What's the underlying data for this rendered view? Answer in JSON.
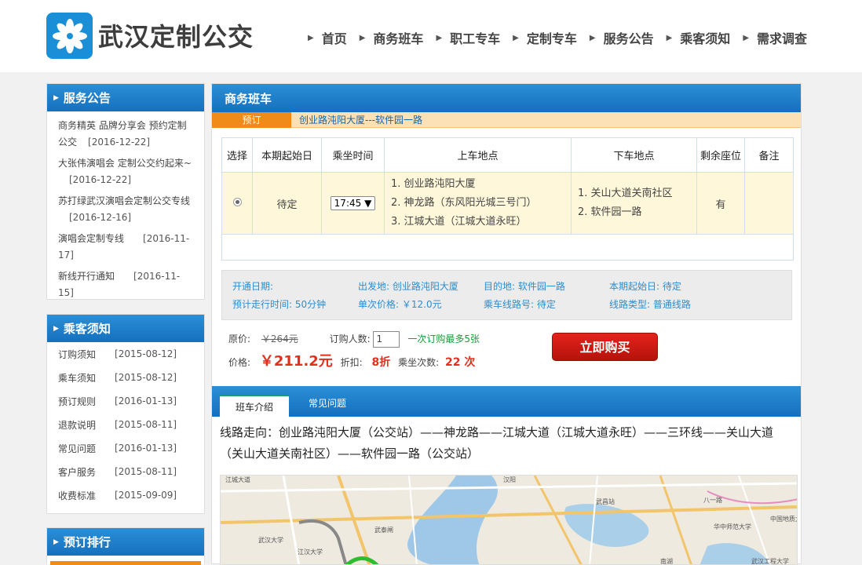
{
  "header": {
    "site_title": "武汉定制公交",
    "nav": [
      "首页",
      "商务班车",
      "职工专车",
      "定制专车",
      "服务公告",
      "乘客须知",
      "需求调查"
    ]
  },
  "sidebar": {
    "announcements": {
      "title": "服务公告",
      "items": [
        {
          "text": "商务精英 品牌分享会 预约定制公交",
          "date": "[2016-12-22]"
        },
        {
          "text": "大张伟演唱会 定制公交约起来~",
          "date": "[2016-12-22]"
        },
        {
          "text": "苏打绿武汉演唱会定制公交专线",
          "date": "[2016-12-16]"
        },
        {
          "text": "演唱会定制专线",
          "date": "[2016-11-17]"
        },
        {
          "text": "新线开行通知",
          "date": "[2016-11-15]"
        }
      ]
    },
    "notices": {
      "title": "乘客须知",
      "items": [
        {
          "text": "订购须知",
          "date": "[2015-08-12]"
        },
        {
          "text": "乘车须知",
          "date": "[2015-08-12]"
        },
        {
          "text": "预订规则",
          "date": "[2016-01-13]"
        },
        {
          "text": "退款说明",
          "date": "[2015-08-11]"
        },
        {
          "text": "常见问题",
          "date": "[2016-01-13]"
        },
        {
          "text": "客户服务",
          "date": "[2015-08-11]"
        },
        {
          "text": "收费标准",
          "date": "[2015-09-09]"
        }
      ]
    },
    "ranking": {
      "title": "预订排行"
    }
  },
  "main": {
    "title": "商务班车",
    "route_tag": "预订",
    "route_name": "创业路沌阳大厦---软件园一路",
    "table": {
      "headers": [
        "选择",
        "本期起始日",
        "乘坐时间",
        "上车地点",
        "下车地点",
        "剩余座位",
        "备注"
      ],
      "row": {
        "start_date": "待定",
        "time": "17:45",
        "pickup": [
          "1. 创业路沌阳大厦",
          "2. 神龙路（东风阳光城三号门）",
          "3. 江城大道（江城大道永旺）"
        ],
        "dropoff": [
          "1. 关山大道关南社区",
          "2. 软件园一路"
        ],
        "seats": "有",
        "note": ""
      }
    },
    "info": {
      "open_date": "开通日期:",
      "departure": "出发地: 创业路沌阳大厦",
      "destination": "目的地: 软件园一路",
      "period_start": "本期起始日: 待定",
      "duration": "预计走行时间: 50分钟",
      "unit_price": "单次价格: ￥12.0元",
      "line_no": "乘车线路号: 待定",
      "line_type": "线路类型:  普通线路"
    },
    "price": {
      "original_label": "原价:",
      "original": "￥264元",
      "qty_label": "订购人数:",
      "qty": "1",
      "qty_note": "一次订购最多5张",
      "price_label": "价格:",
      "price": "￥211.2元",
      "discount_label": "折扣:",
      "discount": "8折",
      "rides_label": "乘坐次数:",
      "rides": "22 次",
      "buy": "立即购买"
    },
    "tabs": [
      "班车介绍",
      "常见问题"
    ],
    "description": "线路走向：创业路沌阳大厦（公交站）——神龙路——江城大道（江城大道永旺）——三环线——关山大道（关山大道关南社区）——软件园一路（公交站）",
    "map_labels": [
      "江城大道",
      "汉阳",
      "武汉大学",
      "华中师范大学",
      "武昌站",
      "八一路",
      "中国地质大学",
      "江汉大学",
      "武汉工程大学",
      "武泰闸",
      "南湖"
    ]
  },
  "colors": {
    "brand_blue": "#1570bf",
    "accent_orange": "#f08a19",
    "buy_red": "#d21d14",
    "price_red": "#e0301e"
  }
}
